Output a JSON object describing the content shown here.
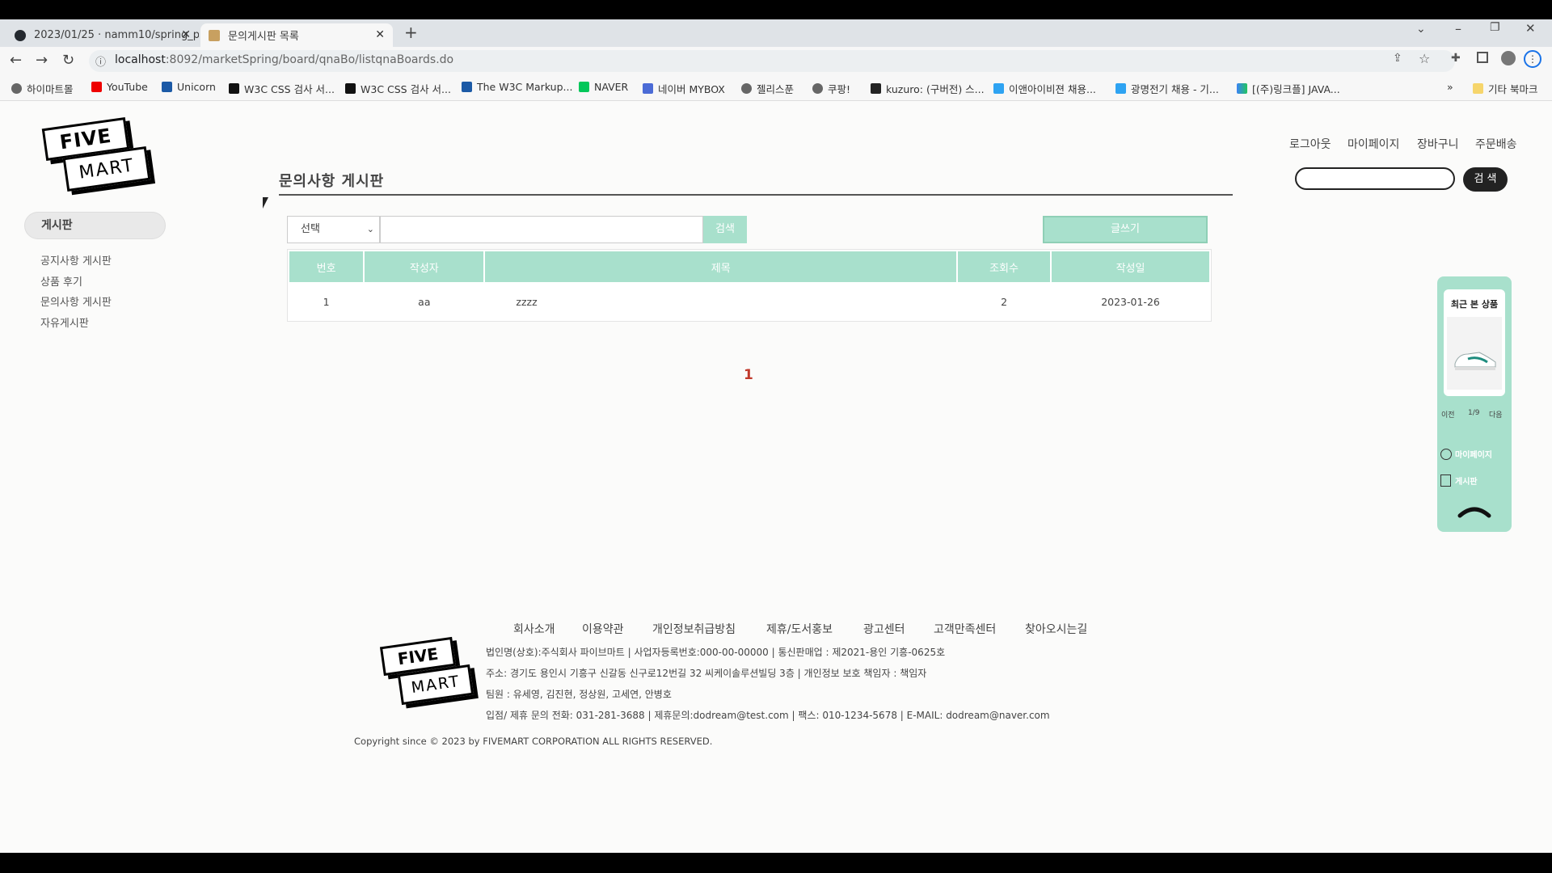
{
  "browser": {
    "tabs": [
      {
        "label": "2023/01/25 · namm10/spring_p"
      },
      {
        "label": "문의게시판 목록"
      }
    ],
    "url_host": "localhost",
    "url_path": ":8092/marketSpring/board/qnaBo/listqnaBoards.do",
    "bookmarks": [
      "하이마트몰",
      "YouTube",
      "Unicorn",
      "W3C CSS 검사 서...",
      "W3C CSS 검사 서...",
      "The W3C Markup...",
      "NAVER",
      "네이버 MYBOX",
      "젤리스푼",
      "쿠팡!",
      "kuzuro: (구버전) 스...",
      "이앤아이비젼 채용...",
      "광명전기 채용 - 기...",
      "[(주)링크플] JAVA..."
    ],
    "bookmarks_more": "»",
    "other_bookmarks": "기타 북마크"
  },
  "logo": {
    "line1": "FIVE",
    "line2": "MART"
  },
  "top_nav": [
    "로그아웃",
    "마이페이지",
    "장바구니",
    "주문배송"
  ],
  "search": {
    "button": "검 색",
    "value": ""
  },
  "sidebar": {
    "title": "게시판",
    "items": [
      "공지사항 게시판",
      "상품 후기",
      "문의사항 게시판",
      "자유게시판"
    ]
  },
  "board": {
    "title": "문의사항 게시판",
    "filter_select": "선택",
    "search_button": "검색",
    "write_button": "글쓰기",
    "columns": [
      "번호",
      "작성자",
      "제목",
      "조회수",
      "작성일"
    ],
    "rows": [
      {
        "no": "1",
        "author": "aa",
        "title": "zzzz",
        "views": "2",
        "date": "2023-01-26"
      }
    ],
    "current_page": "1"
  },
  "recent": {
    "title": "최근 본 상품",
    "prev": "이전",
    "counter": "1/9",
    "next": "다음",
    "mypage": "마이페이지",
    "board": "게시판"
  },
  "footer": {
    "links": [
      "회사소개",
      "이용약관",
      "개인정보취급방침",
      "제휴/도서홍보",
      "광고센터",
      "고객만족센터",
      "찾아오시는길"
    ],
    "info": [
      "법인명(상호):주식회사 파이브마트  |  사업자등록번호:000-00-00000  |  통신판매업 : 제2021-용인 기흥-0625호",
      "주소: 경기도 용인시 기흥구 신갈동 신구로12번길 32 씨케이솔루션빌딩 3층  |  개인정보 보호 책임자 : 책임자",
      "팀원 : 유세영, 김진현, 정상원, 고세연, 안병호",
      "입점/ 제휴 문의 전화: 031-281-3688  | 제휴문의:dodream@test.com  |  팩스: 010-1234-5678  |  E-MAIL: dodream@naver.com"
    ],
    "copyright": "Copyright since © 2023 by FIVEMART CORPORATION ALL RIGHTS RESERVED."
  },
  "colors": {
    "accent": "#a8e0cc",
    "page_bg": "#fbfbfa",
    "current_page": "#c0392b"
  }
}
